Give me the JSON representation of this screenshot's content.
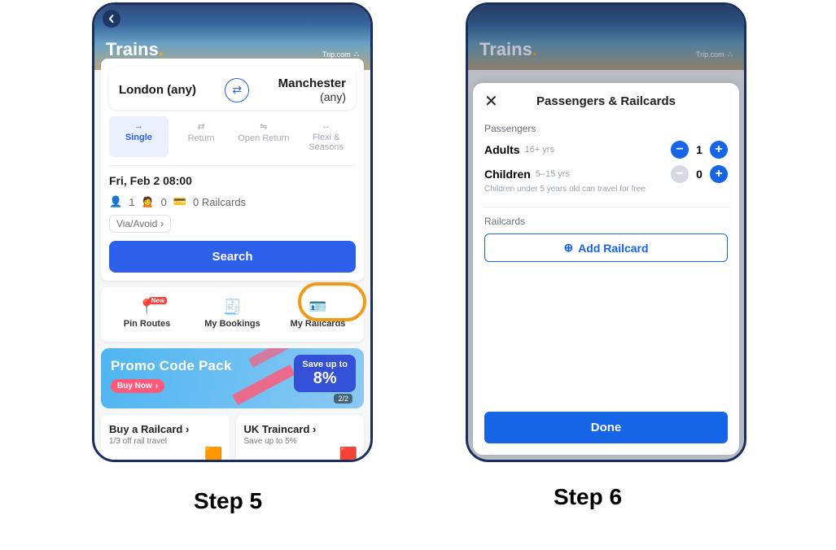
{
  "step5": {
    "label": "Step 5",
    "hero_title": "Trains",
    "brand": "Trip.com",
    "from": "London (any)",
    "to_line1": "Manchester",
    "to_line2": "(any)",
    "trip_types": {
      "single": "Single",
      "return": "Return",
      "open": "Open Return",
      "flexi": "Flexi & Seasons"
    },
    "datetime": "Fri, Feb 2 08:00",
    "pax_adults": "1",
    "pax_children": "0",
    "pax_railcards": "0 Railcards",
    "via": "Via/Avoid",
    "search": "Search",
    "quick": {
      "pin": "Pin Routes",
      "pin_badge": "New",
      "bookings": "My Bookings",
      "railcards": "My Railcards"
    },
    "promo": {
      "title": "Promo Code Pack",
      "buy": "Buy Now",
      "save_label": "Save up to",
      "save_pct": "8%",
      "pager": "2/2"
    },
    "buy_rc": {
      "title": "Buy a Railcard",
      "sub": "1/3 off rail travel"
    },
    "uk_tc": {
      "title": "UK Traincard",
      "sub": "Save up to 5%"
    }
  },
  "step6": {
    "label": "Step 6",
    "hero_title": "Trains",
    "brand": "Trip.com",
    "sheet_title": "Passengers & Railcards",
    "sec_passengers": "Passengers",
    "adults_label": "Adults",
    "adults_hint": "16+ yrs",
    "adults_count": "1",
    "children_label": "Children",
    "children_hint": "5–15 yrs",
    "children_count": "0",
    "children_note": "Children under 5 years old can travel for free",
    "sec_railcards": "Railcards",
    "add_rc": "Add Railcard",
    "done": "Done"
  }
}
